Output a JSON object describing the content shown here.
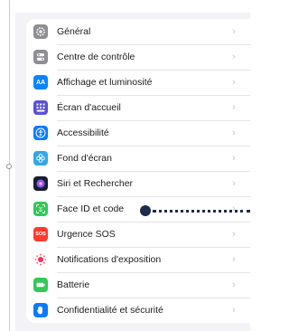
{
  "settings": {
    "items": [
      {
        "label": "Général",
        "icon": "gear-icon",
        "color": "#8e8e93"
      },
      {
        "label": "Centre de contrôle",
        "icon": "toggles-icon",
        "color": "#8e8e93"
      },
      {
        "label": "Affichage et luminosité",
        "icon": "aa-icon",
        "glyph": "AA",
        "color": "#0a84ff"
      },
      {
        "label": "Écran d'accueil",
        "icon": "home-grid-icon",
        "color": "#5b4fd6"
      },
      {
        "label": "Accessibilité",
        "icon": "accessibility-icon",
        "color": "#0a7aff"
      },
      {
        "label": "Fond d'écran",
        "icon": "flower-icon",
        "color": "#33a7e8"
      },
      {
        "label": "Siri et Rechercher",
        "icon": "siri-icon",
        "color": "#1c1c2e"
      },
      {
        "label": "Face ID et code",
        "icon": "face-id-icon",
        "color": "#34c759"
      },
      {
        "label": "Urgence SOS",
        "icon": "sos-icon",
        "glyph": "SOS",
        "color": "#ff3b30"
      },
      {
        "label": "Notifications d'exposition",
        "icon": "exposure-icon",
        "color": "#ffffff"
      },
      {
        "label": "Batterie",
        "icon": "battery-icon",
        "color": "#34c759"
      },
      {
        "label": "Confidentialité et sécurité",
        "icon": "hand-icon",
        "color": "#0a7aff"
      }
    ],
    "chevron": "›"
  },
  "callout": {
    "target": "Face ID et code",
    "color": "#1d2b4d"
  }
}
